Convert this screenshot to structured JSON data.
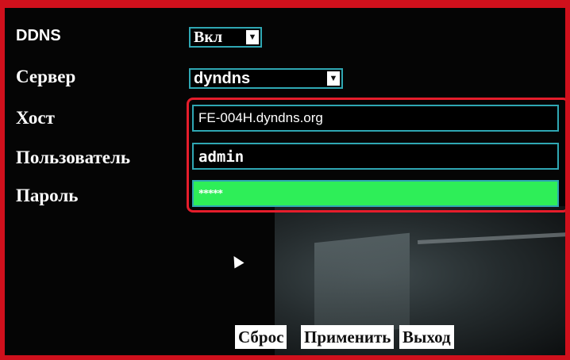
{
  "labels": {
    "ddns": "DDNS",
    "server": "Сервер",
    "host": "Хост",
    "user": "Пользователь",
    "password": "Пароль"
  },
  "ddns_select": {
    "value": "Вкл"
  },
  "server_select": {
    "value": "dyndns"
  },
  "host_field": {
    "value": "FE-004H.dyndns.org"
  },
  "user_field": {
    "value": "admin"
  },
  "password_field": {
    "value": "*****"
  },
  "buttons": {
    "reset": "Сброс",
    "apply": "Применить",
    "exit": "Выход"
  },
  "icons": {
    "dropdown": "chevron-down-icon",
    "pointer": "mouse-pointer-icon"
  },
  "colors": {
    "frame": "#d0101c",
    "field_border": "#2fa7b3",
    "password_bg": "#2eee58",
    "highlight": "#e51d2b"
  }
}
